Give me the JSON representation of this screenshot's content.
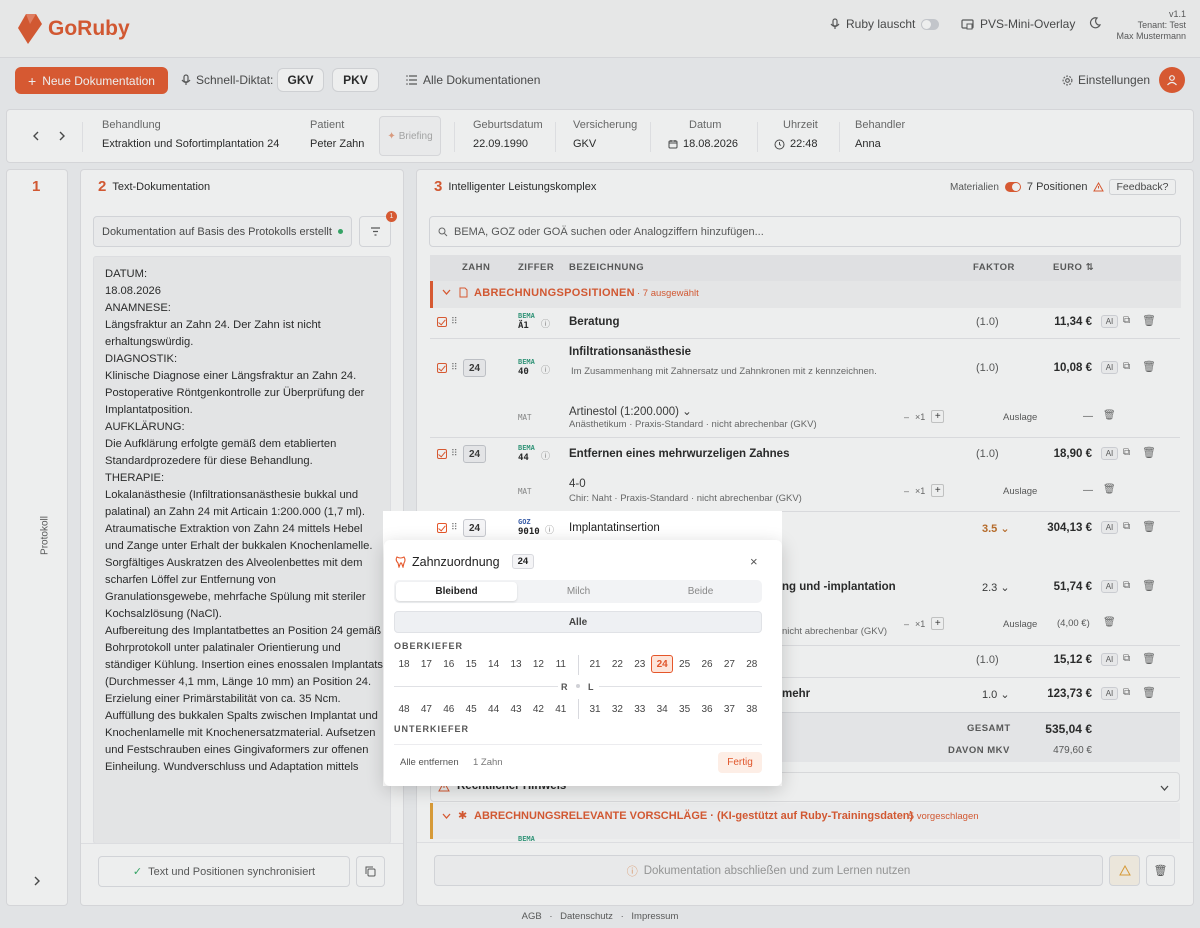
{
  "app": {
    "brand": "GoRuby",
    "version": "v1.1",
    "tenant": "Tenant: Test",
    "user": "Max Mustermann"
  },
  "header": {
    "ruby_listening": "Ruby lauscht",
    "pvs_overlay": "PVS-Mini-Overlay"
  },
  "toolbar": {
    "new_doc": "Neue Dokumentation",
    "quick_dictation": "Schnell-Diktat:",
    "gkv": "GKV",
    "pkv": "PKV",
    "all_docs": "Alle Dokumentationen",
    "settings": "Einstellungen"
  },
  "info": {
    "behandlung_label": "Behandlung",
    "behandlung": "Extraktion und Sofortimplantation 24",
    "patient_label": "Patient",
    "patient": "Peter Zahn",
    "briefing": "Briefing",
    "geburtsdatum_label": "Geburtsdatum",
    "geburtsdatum": "22.09.1990",
    "versicherung_label": "Versicherung",
    "versicherung": "GKV",
    "datum_label": "Datum",
    "datum": "18.08.2026",
    "uhrzeit_label": "Uhrzeit",
    "uhrzeit": "22:48",
    "behandler_label": "Behandler",
    "behandler": "Anna"
  },
  "panel1": {
    "num": "1",
    "label": "Protokoll"
  },
  "panel2": {
    "num": "2",
    "title": "Text-Dokumentation",
    "source": "Dokumentation auf Basis des Protokolls erstellt",
    "filter_badge": "1",
    "doc_lines": [
      "DATUM:",
      "18.08.2026",
      "",
      "ANAMNESE:",
      "Längsfraktur an Zahn 24. Der Zahn ist nicht",
      "erhaltungswürdig.",
      "",
      "DIAGNOSTIK:",
      "Klinische Diagnose einer Längsfraktur an Zahn 24.",
      "Postoperative Röntgenkontrolle zur Überprüfung der",
      "Implantatposition.",
      "",
      "AUFKLÄRUNG:",
      "Die Aufklärung erfolgte gemäß dem etablierten",
      "Standardprozedere für diese Behandlung.",
      "",
      "THERAPIE:",
      "Lokalanästhesie (Infiltrationsanästhesie bukkal und",
      "palatinal) an Zahn 24 mit Articain 1:200.000 (1,7 ml).",
      "Atraumatische Extraktion von Zahn 24 mittels Hebel",
      "und Zange unter Erhalt der bukkalen Knochenlamelle.",
      "Sorgfältiges Auskratzen des Alveolenbettes mit dem",
      "scharfen Löffel zur Entfernung von",
      "Granulationsgewebe, mehrfache Spülung mit steriler",
      "Kochsalzlösung (NaCl).",
      "Aufbereitung des Implantatbettes an Position 24 gemäß",
      "Bohrprotokoll unter palatinaler Orientierung und",
      "ständiger Kühlung. Insertion eines enossalen Implantats",
      "(Durchmesser 4,1 mm, Länge 10 mm) an Position 24.",
      "Erzielung einer Primärstabilität von ca. 35 Ncm.",
      "Auffüllung des bukkalen Spalts zwischen Implantat und",
      "Knochenlamelle mit Knochenersatzmaterial. Aufsetzen",
      "und Festschrauben eines Gingivaformers zur offenen",
      "Einheilung. Wundverschluss und Adaptation mittels"
    ],
    "sync": "Text und Positionen synchronisiert"
  },
  "panel3": {
    "num": "3",
    "title": "Intelligenter Leistungskomplex",
    "materials": "Materialien",
    "positions": "7 Positionen",
    "feedback": "Feedback?",
    "search_placeholder": "BEMA, GOZ oder GOÄ suchen oder Analogziffern hinzufügen...",
    "col_zahn": "ZAHN",
    "col_ziffer": "ZIFFER",
    "col_bez": "BEZEICHNUNG",
    "col_faktor": "FAKTOR",
    "col_euro": "EURO",
    "section": "ABRECHNUNGSPOSITIONEN",
    "section_count": "· 7 ausgewählt",
    "rows": [
      {
        "type": "BEMA",
        "code": "Ä1",
        "title": "Beratung",
        "faktor": "(1.0)",
        "euro": "11,34 €"
      },
      {
        "zahn": "24",
        "type": "BEMA",
        "code": "40",
        "title": "Infiltrationsanästhesie",
        "sub": "Im Zusammenhang mit Zahnersatz und Zahnkronen mit z kennzeichnen.",
        "faktor": "(1.0)",
        "euro": "10,08 €"
      },
      {
        "zahn": "24",
        "type": "BEMA",
        "code": "44",
        "title": "Entfernen eines mehrwurzeligen Zahnes",
        "faktor": "(1.0)",
        "euro": "18,90 €"
      },
      {
        "zahn": "24",
        "type": "GOZ",
        "code": "9010",
        "title": "Implantatinsertion",
        "faktor": "3.5",
        "euro": "304,13 €"
      }
    ],
    "mat1": {
      "tag": "MAT",
      "title": "Artinestol (1:200.000)",
      "sub": "Anästhetikum · Praxis-Standard · nicht abrechenbar (GKV)",
      "qty": "×1",
      "auslage": "Auslage",
      "price": "—"
    },
    "mat2": {
      "tag": "MAT",
      "title": "4-0",
      "sub": "Chir: Naht · Praxis-Standard · nicht abrechenbar (GKV)",
      "qty": "×1",
      "auslage": "Auslage",
      "price": "—"
    },
    "row5_title_tail": "ng und -implantation",
    "row5_faktor": "2.3",
    "row5_euro": "51,74 €",
    "mat3": {
      "sub_tail": "nicht abrechenbar (GKV)",
      "qty": "×1",
      "auslage": "Auslage",
      "price": "(4,00 €)"
    },
    "row6_faktor": "(1.0)",
    "row6_euro": "15,12 €",
    "row7_title_tail": "mehr",
    "row7_faktor": "1.0",
    "row7_euro": "123,73 €",
    "gesamt_label": "GESAMT",
    "gesamt": "535,04 €",
    "mkv_label": "DAVON MKV",
    "mkv": "479,60 €",
    "legal": "Rechtlicher Hinweis",
    "suggest": "ABRECHNUNGSRELEVANTE VORSCHLÄGE · (KI-gestützt auf Ruby-Trainingsdaten)",
    "suggest_count": "· 5 vorgeschlagen",
    "suggest_code": "BEMA",
    "finish": "Dokumentation abschließen und zum Lernen nutzen"
  },
  "popup": {
    "title": "Zahnzuordnung",
    "tooth": "24",
    "tab_bleibend": "Bleibend",
    "tab_milch": "Milch",
    "tab_beide": "Beide",
    "all": "Alle",
    "oberkiefer": "OBERKIEFER",
    "unterkiefer": "UNTERKIEFER",
    "r": "R",
    "l": "L",
    "upper_right": [
      "18",
      "17",
      "16",
      "15",
      "14",
      "13",
      "12",
      "11"
    ],
    "upper_left": [
      "21",
      "22",
      "23",
      "24",
      "25",
      "26",
      "27",
      "28"
    ],
    "lower_right": [
      "48",
      "47",
      "46",
      "45",
      "44",
      "43",
      "42",
      "41"
    ],
    "lower_left": [
      "31",
      "32",
      "33",
      "34",
      "35",
      "36",
      "37",
      "38"
    ],
    "selected": "24",
    "remove_all": "Alle entfernen",
    "count": "1 Zahn",
    "done": "Fertig"
  },
  "footer": {
    "agb": "AGB",
    "datenschutz": "Datenschutz",
    "impressum": "Impressum"
  },
  "colors": {
    "accent": "#e5562a",
    "bema": "#2c9a7a",
    "goz": "#3a5ea8"
  }
}
